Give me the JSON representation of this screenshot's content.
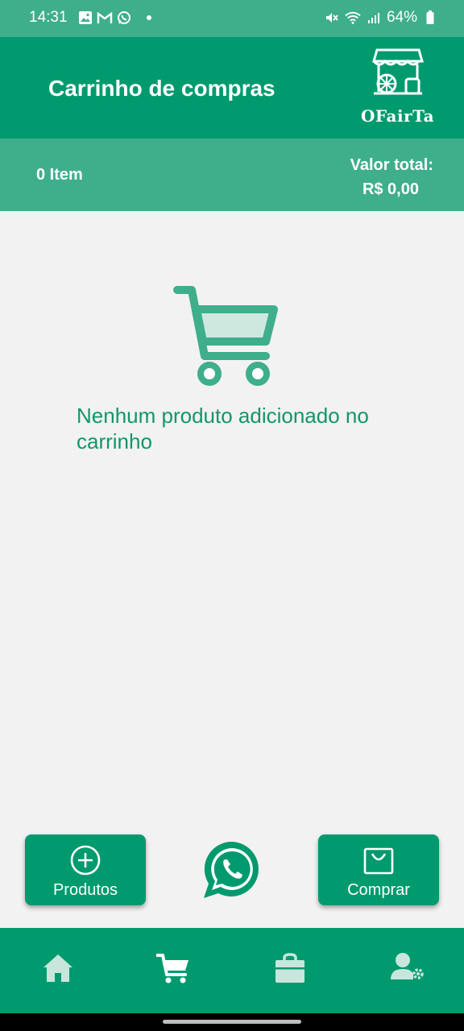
{
  "status_bar": {
    "time": "14:31",
    "battery": "64%",
    "icons": [
      "gallery-icon",
      "gmail-icon",
      "whatsapp-icon",
      "notification-dot",
      "mute-icon",
      "wifi-icon",
      "signal-icon",
      "battery-icon"
    ]
  },
  "header": {
    "title": "Carrinho de compras",
    "logo_text": "OFairTa"
  },
  "summary": {
    "item_count": "0 Item",
    "total_label": "Valor total:",
    "total_value": "R$ 0,00"
  },
  "empty_state": {
    "message": "Nenhum produto adicionado no carrinho",
    "icon": "cart-icon"
  },
  "actions": {
    "products_label": "Produtos",
    "products_icon": "plus-circle-icon",
    "buy_label": "Comprar",
    "buy_icon": "bag-icon",
    "whatsapp_icon": "whatsapp-icon"
  },
  "bottom_nav": {
    "items": [
      {
        "icon": "home-icon",
        "active": false
      },
      {
        "icon": "cart-icon",
        "active": true
      },
      {
        "icon": "shopping-bag-icon",
        "active": false
      },
      {
        "icon": "user-settings-icon",
        "active": false
      }
    ]
  },
  "colors": {
    "primary": "#009a6e",
    "secondary": "#3fae8b",
    "background": "#f2f2f2",
    "text_accent": "#13956b",
    "nav_inactive": "#c8e6dc"
  }
}
